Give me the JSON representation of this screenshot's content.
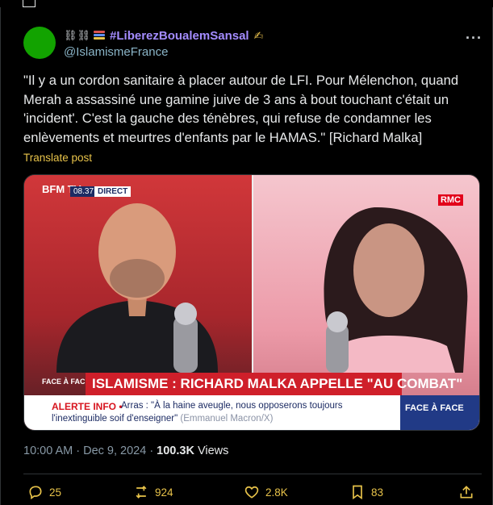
{
  "tweet": {
    "display_name": "#LiberezBoualemSansal",
    "handle": "@IslamismeFrance",
    "more_icon": "ellipsis-icon",
    "text": "\"Il y a un cordon sanitaire à placer autour de LFI. Pour Mélenchon, quand Merah a assassiné une gamine juive de 3 ans à bout touchant c'était un 'incident'. C'est la gauche des ténèbres, qui refuse de condamner les enlèvements et meurtres d'enfants par le HAMAS.\" [Richard Malka]",
    "translate_label": "Translate post",
    "time": "10:00 AM",
    "date": "Dec 9, 2024",
    "views_count": "100.3K",
    "views_label": "Views",
    "colors": {
      "avatar": "#12a300",
      "name": "#a48cff",
      "accent": "#e8c34a"
    }
  },
  "media": {
    "channel_left": "BFM TV.",
    "clock": "08.37",
    "live_label": "DIRECT",
    "channel_right": "RMC",
    "segment_badge": "FACE À FACE",
    "headline": "ISLAMISME : RICHARD MALKA APPELLE \"AU COMBAT\"",
    "alert_label": "ALERTE INFO •",
    "alert_line1": "Arras : \"À la haine aveugle, nous opposerons toujours",
    "alert_line2": "l'inextinguible soif d'enseigner\"",
    "alert_source": "(Emmanuel Macron/X)",
    "show_name": "FACE À FACE"
  },
  "actions": {
    "replies": "25",
    "reposts": "924",
    "likes": "2.8K",
    "bookmarks": "83"
  }
}
